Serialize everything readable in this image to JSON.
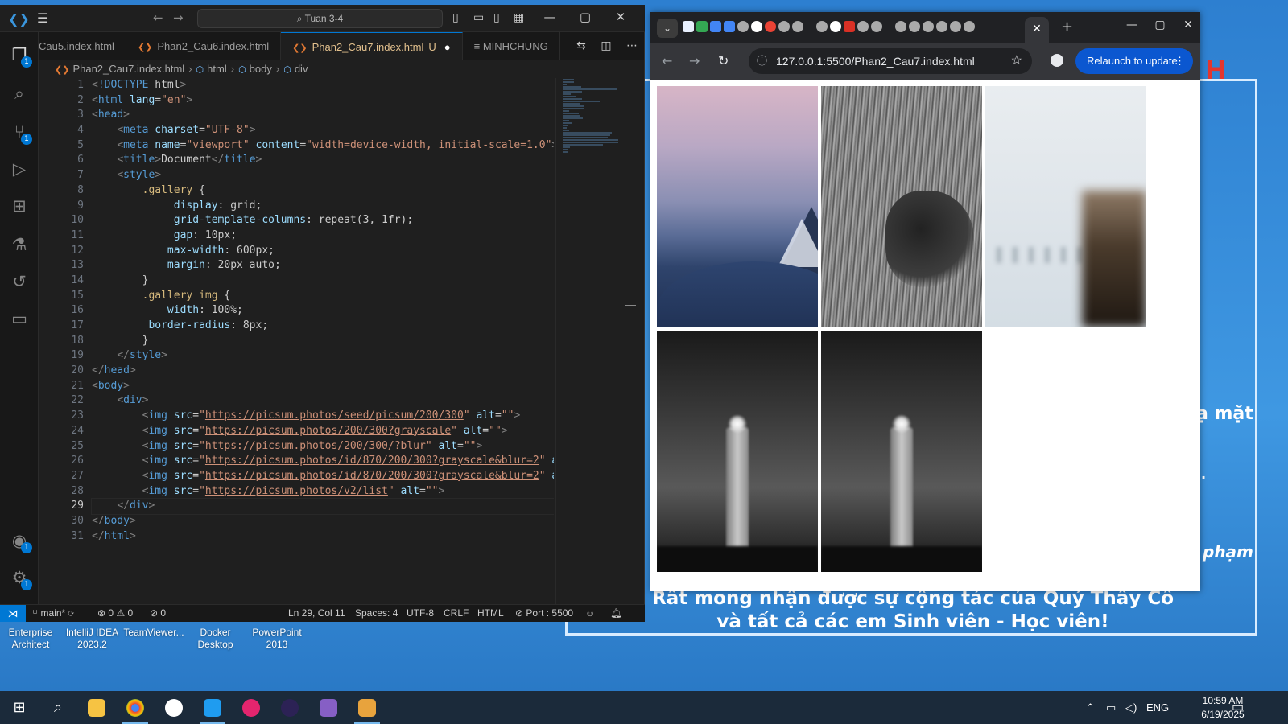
{
  "vscode": {
    "search_text": "Tuan 3-4",
    "tabs": [
      {
        "label": "Cau5.index.html"
      },
      {
        "label": "Phan2_Cau6.index.html"
      },
      {
        "label": "Phan2_Cau7.index.html",
        "modified": "U"
      },
      {
        "label": "MINHCHUNG"
      }
    ],
    "breadcrumbs": [
      "Phan2_Cau7.index.html",
      "html",
      "body",
      "div"
    ],
    "line_numbers": [
      "1",
      "2",
      "3",
      "4",
      "5",
      "6",
      "7",
      "8",
      "9",
      "10",
      "11",
      "12",
      "13",
      "14",
      "15",
      "16",
      "17",
      "18",
      "19",
      "20",
      "21",
      "22",
      "23",
      "24",
      "25",
      "26",
      "27",
      "28",
      "29",
      "30",
      "31"
    ],
    "code_lines": [
      "<!DOCTYPE html>",
      "<html lang=\"en\">",
      "<head>",
      "    <meta charset=\"UTF-8\">",
      "    <meta name=\"viewport\" content=\"width=device-width, initial-scale=1.0\">",
      "    <title>Document</title>",
      "    <style>",
      "        .gallery {",
      "             display: grid;",
      "             grid-template-columns: repeat(3, 1fr);",
      "             gap: 10px;",
      "            max-width: 600px;",
      "            margin: 20px auto;",
      "        }",
      "        .gallery img {",
      "            width: 100%;",
      "         border-radius: 8px;",
      "        }",
      "    </style>",
      "</head>",
      "<body>",
      "    <div>",
      "        <img src=\"https://picsum.photos/seed/picsum/200/300\" alt=\"\">",
      "        <img src=\"https://picsum.photos/200/300?grayscale\" alt=\"\">",
      "        <img src=\"https://picsum.photos/200/300/?blur\" alt=\"\">",
      "        <img src=\"https://picsum.photos/id/870/200/300?grayscale&blur=2\" alt=",
      "        <img src=\"https://picsum.photos/id/870/200/300?grayscale&blur=2\" alt=",
      "        <img src=\"https://picsum.photos/v2/list\" alt=\"\">",
      "    </div>",
      "</body>",
      "</html>"
    ],
    "current_line": "29",
    "status": {
      "branch": "main*",
      "errors": "0",
      "warnings": "0",
      "ports": "0",
      "position": "Ln 29, Col 11",
      "spaces": "Spaces: 4",
      "encoding": "UTF-8",
      "eol": "CRLF",
      "language": "HTML",
      "port": "Port : 5500"
    },
    "activity_badges": {
      "explorer": "1",
      "scm": "1",
      "accounts": "1",
      "settings": "1"
    }
  },
  "chrome": {
    "url": "127.0.0.1:5500/Phan2_Cau7.index.html",
    "relaunch_label": "Relaunch to update"
  },
  "desktop": {
    "icons": [
      {
        "label": "Enterprise Architect"
      },
      {
        "label": "IntelliJ IDEA 2023.2"
      },
      {
        "label": "TeamViewer..."
      },
      {
        "label": "Docker Desktop"
      },
      {
        "label": "PowerPoint 2013"
      }
    ],
    "bg_letter": "H",
    "bg_text_1": "ạ mặt",
    "bg_text_2": "phạm",
    "bg_text_3": "Rất mong nhận được sự cộng tác của Quý Thầy Cô và tất cả các em Sinh viên - Học viên!"
  },
  "taskbar": {
    "language": "ENG",
    "time": "10:59 AM",
    "date": "6/19/2025"
  },
  "colors": {
    "vscode_bg": "#1f1f1f",
    "accent": "#0078d4",
    "relaunch": "#0b57d0",
    "desktop": "#3a8fd6"
  }
}
